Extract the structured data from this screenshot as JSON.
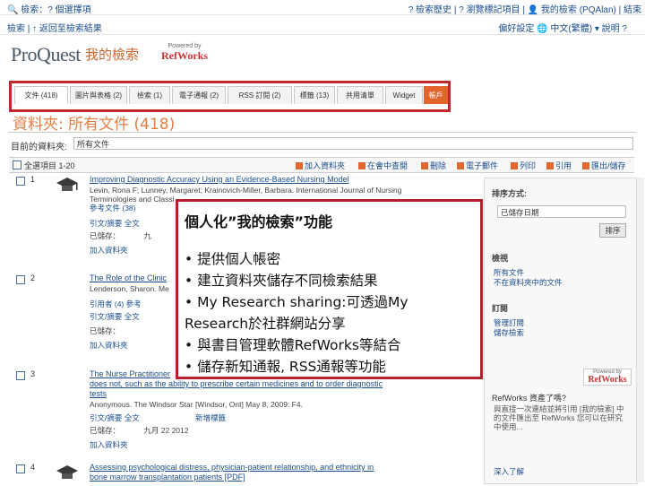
{
  "topbar": {
    "left": "🔍 檢索：? 個選擇項",
    "right": "? 檢索歷史 | ? 瀏覽標記項目 | 👤 我的檢索 (PQAlan) | 結束"
  },
  "subbar": {
    "left": "檢索 | ↑ 返回至檢索結果",
    "right": "偏好設定   🌐 中文(繁體) ▾   說明 ?"
  },
  "logo": {
    "brand": "ProQuest",
    "section": "我的檢索",
    "powered_by": "Powered by",
    "refworks": "RefWorks"
  },
  "tabs": [
    {
      "label": "文件 (418)"
    },
    {
      "label": "圖片與表格 (2)"
    },
    {
      "label": "檢索 (1)"
    },
    {
      "label": "電子通報 (2)"
    },
    {
      "label": "RSS 訂閱 (2)"
    },
    {
      "label": "標籤 (13)"
    },
    {
      "label": "共用清單"
    },
    {
      "label": "Widget"
    },
    {
      "label": "帳戶"
    }
  ],
  "folder_title": "資料夾: 所有文件 (418)",
  "custom": {
    "label": "目前的資料夾:",
    "value": "所有文件"
  },
  "toolbar": {
    "select_label": "全選項目 1-20",
    "actions": [
      "加入資料夾",
      "在會中查閱",
      "刪除",
      "電子郵件",
      "列印",
      "引用",
      "匯出/儲存"
    ]
  },
  "results": [
    {
      "num": "1",
      "title": "Improving Diagnostic Accuracy Using an Evidence-Based Nursing Model",
      "meta1": "Levin, Rona F; Lunney, Margaret; Krainovich-Miller, Barbara. International Journal of Nursing",
      "meta2": "Terminologies and Classi",
      "meta3": "參考文件 (38)",
      "links1": "引文/摘要   全文",
      "saved_label": "已儲存：",
      "saved_value": "九",
      "add_label": "加入資料夾"
    },
    {
      "num": "2",
      "title": "The Role of the Clinic",
      "meta1": "Lenderson, Sharon. Me",
      "links0": "引用者 (4)   參考",
      "links1": "引文/摘要   全文",
      "saved_label": "已儲存：",
      "add_label": "加入資料夾"
    },
    {
      "num": "3",
      "title": "The Nurse Practitioner",
      "title2": "does not, such as the ability to prescribe certain medicines and to order diagnostic",
      "title3": "tests",
      "meta1": "Anonymous. The Windsor Star [Windsor, Ont] May 8, 2009: F4.",
      "links1": "引文/摘要   全文",
      "tag_label": "新增標籤",
      "saved_label": "已儲存：",
      "saved_value": "九月 22 2012",
      "add_label": "加入資料夾"
    },
    {
      "num": "4",
      "title": "Assessing psychological distress, physician-patient relationship, and ethnicity in",
      "title2": "bone marrow transplantation patients [PDF]"
    }
  ],
  "sidebar": {
    "sort_head": "排序方式:",
    "sort_value": "已儲存日期",
    "update_btn": "排序",
    "folder_head": "檢視",
    "folder_links": [
      "所有文件",
      "不在資料夾中的文件"
    ],
    "feature_head": "訂閱",
    "feature_links": [
      "管理訂閱",
      "儲存檢索"
    ],
    "rw_powered": "Powered by",
    "rw_brand": "RefWorks",
    "rw_title": "RefWorks 資產了嗎?",
    "rw_text": "與直接一次連結並將引用 [我的檢索] 中的文件匯出至 RefWorks 您可以在研究中使用...",
    "rw_link": "深入了解"
  },
  "callout": {
    "title": "個人化”我的檢索”功能",
    "bullets": [
      "• 提供個人帳密",
      "•  建立資料夾儲存不同檢索結果",
      "• My Research sharing:可透過My",
      "Research於社群網站分享",
      "• 與書目管理軟體RefWorks等結合",
      "• 儲存新知通報, RSS通報等功能"
    ]
  }
}
